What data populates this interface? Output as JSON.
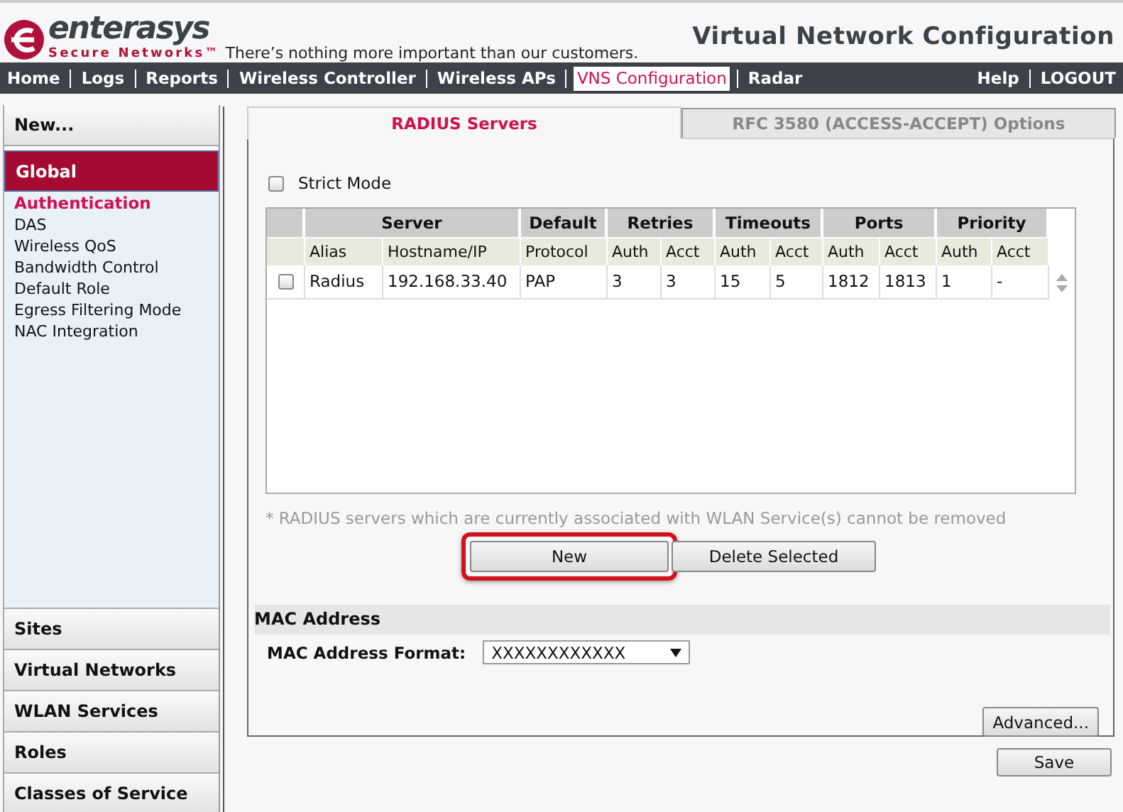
{
  "header": {
    "brand": "enterasys",
    "brand_sub": "Secure Networks™",
    "tagline": "There’s nothing more important than our customers.",
    "title": "Virtual Network Configuration"
  },
  "nav": {
    "left": [
      {
        "label": "Home",
        "selected": false
      },
      {
        "label": "Logs",
        "selected": false
      },
      {
        "label": "Reports",
        "selected": false
      },
      {
        "label": "Wireless Controller",
        "selected": false
      },
      {
        "label": "Wireless APs",
        "selected": false
      },
      {
        "label": "VNS Configuration",
        "selected": true
      },
      {
        "label": "Radar",
        "selected": false
      }
    ],
    "right": [
      {
        "label": "Help"
      },
      {
        "label": "LOGOUT"
      }
    ]
  },
  "sidebar": {
    "new_label": "New...",
    "sections": [
      {
        "label": "Global",
        "selected": true,
        "children": [
          {
            "label": "Authentication",
            "selected": true
          },
          {
            "label": "DAS",
            "selected": false
          },
          {
            "label": "Wireless QoS",
            "selected": false
          },
          {
            "label": "Bandwidth Control",
            "selected": false
          },
          {
            "label": "Default Role",
            "selected": false
          },
          {
            "label": "Egress Filtering Mode",
            "selected": false
          },
          {
            "label": "NAC Integration",
            "selected": false
          }
        ]
      },
      {
        "label": "Sites",
        "selected": false
      },
      {
        "label": "Virtual Networks",
        "selected": false
      },
      {
        "label": "WLAN Services",
        "selected": false
      },
      {
        "label": "Roles",
        "selected": false
      },
      {
        "label": "Classes of Service",
        "selected": false
      }
    ]
  },
  "tabs": [
    {
      "label": "RADIUS Servers",
      "selected": true
    },
    {
      "label": "RFC 3580 (ACCESS-ACCEPT) Options",
      "selected": false
    }
  ],
  "strict_mode": {
    "label": "Strict Mode",
    "checked": false
  },
  "table": {
    "groups": [
      "Server",
      "Default",
      "Retries",
      "Timeouts",
      "Ports",
      "Priority"
    ],
    "columns": [
      "Alias",
      "Hostname/IP",
      "Protocol",
      "Auth",
      "Acct",
      "Auth",
      "Acct",
      "Auth",
      "Acct",
      "Auth",
      "Acct"
    ],
    "rows": [
      {
        "checked": false,
        "cells": [
          "Radius",
          "192.168.33.40",
          "PAP",
          "3",
          "3",
          "15",
          "5",
          "1812",
          "1813",
          "1",
          "-"
        ]
      }
    ]
  },
  "note": "* RADIUS servers which are currently associated with WLAN Service(s) cannot be removed",
  "buttons": [
    {
      "label": "New",
      "highlighted": true
    },
    {
      "label": "Delete Selected",
      "highlighted": false
    }
  ],
  "mac_section": {
    "title": "MAC Address",
    "format_label": "MAC Address Format:",
    "format_value": "XXXXXXXXXXXX"
  },
  "advanced_button": "Advanced...",
  "save_button": "Save"
}
